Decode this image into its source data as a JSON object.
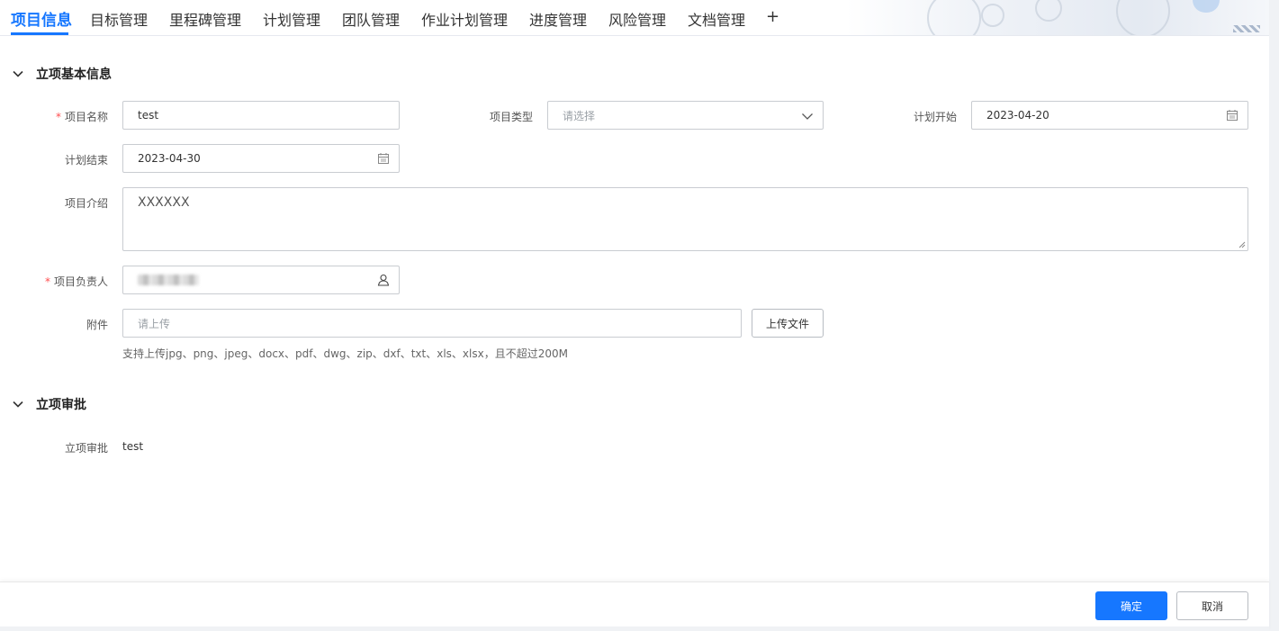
{
  "tabs": [
    {
      "label": "项目信息",
      "active": true
    },
    {
      "label": "目标管理"
    },
    {
      "label": "里程碑管理"
    },
    {
      "label": "计划管理"
    },
    {
      "label": "团队管理"
    },
    {
      "label": "作业计划管理"
    },
    {
      "label": "进度管理"
    },
    {
      "label": "风险管理"
    },
    {
      "label": "文档管理"
    }
  ],
  "tab_add": "+",
  "sections": {
    "basic": {
      "title": "立项基本信息"
    },
    "approval": {
      "title": "立项审批"
    }
  },
  "form": {
    "required_mark": "*",
    "project_name": {
      "label": "项目名称",
      "value": "test"
    },
    "project_type": {
      "label": "项目类型",
      "placeholder": "请选择"
    },
    "plan_start": {
      "label": "计划开始",
      "value": "2023-04-20"
    },
    "plan_end": {
      "label": "计划结束",
      "value": "2023-04-30"
    },
    "intro": {
      "label": "项目介绍",
      "value": "XXXXXX"
    },
    "owner": {
      "label": "项目负责人"
    },
    "attachment": {
      "label": "附件",
      "placeholder": "请上传",
      "upload_button": "上传文件",
      "hint": "支持上传jpg、png、jpeg、docx、pdf、dwg、zip、dxf、txt、xls、xlsx，且不超过200M"
    }
  },
  "approval": {
    "label": "立项审批",
    "value": "test"
  },
  "footer": {
    "confirm": "确定",
    "cancel": "取消"
  },
  "colors": {
    "accent": "#1677ff",
    "required": "#ff4d4f"
  },
  "icons": {
    "calendar": "calendar-icon",
    "user": "user-icon",
    "chevron": "chevron-down-icon"
  }
}
